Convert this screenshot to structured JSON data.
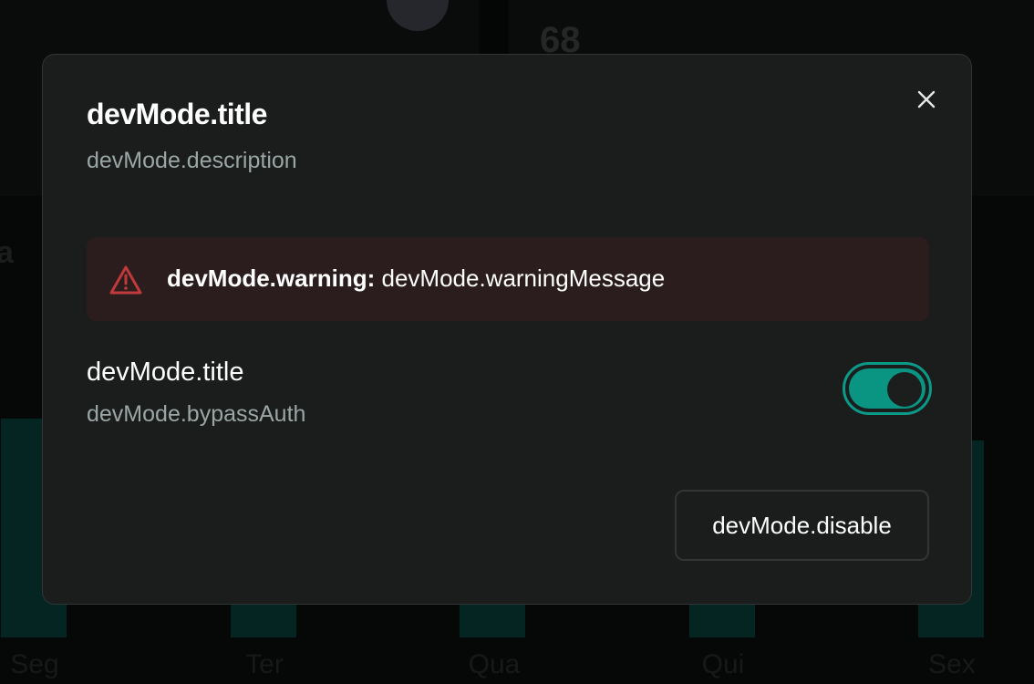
{
  "background": {
    "stat_value": "68",
    "side_letter": "a",
    "weekdays": [
      "Seg",
      "Ter",
      "Qua",
      "Qui",
      "Sex"
    ]
  },
  "modal": {
    "title": "devMode.title",
    "description": "devMode.description",
    "close_icon": "close-icon",
    "warning": {
      "icon": "warning-triangle-icon",
      "label": "devMode.warning:",
      "message": "devMode.warningMessage"
    },
    "setting": {
      "title": "devMode.title",
      "subtitle": "devMode.bypassAuth",
      "enabled": true
    },
    "disable_label": "devMode.disable"
  },
  "colors": {
    "accent": "#0a9583",
    "warning_bg": "#2b1d1d",
    "warning_icon": "#c0393b",
    "modal_bg": "#1b1d1d"
  }
}
